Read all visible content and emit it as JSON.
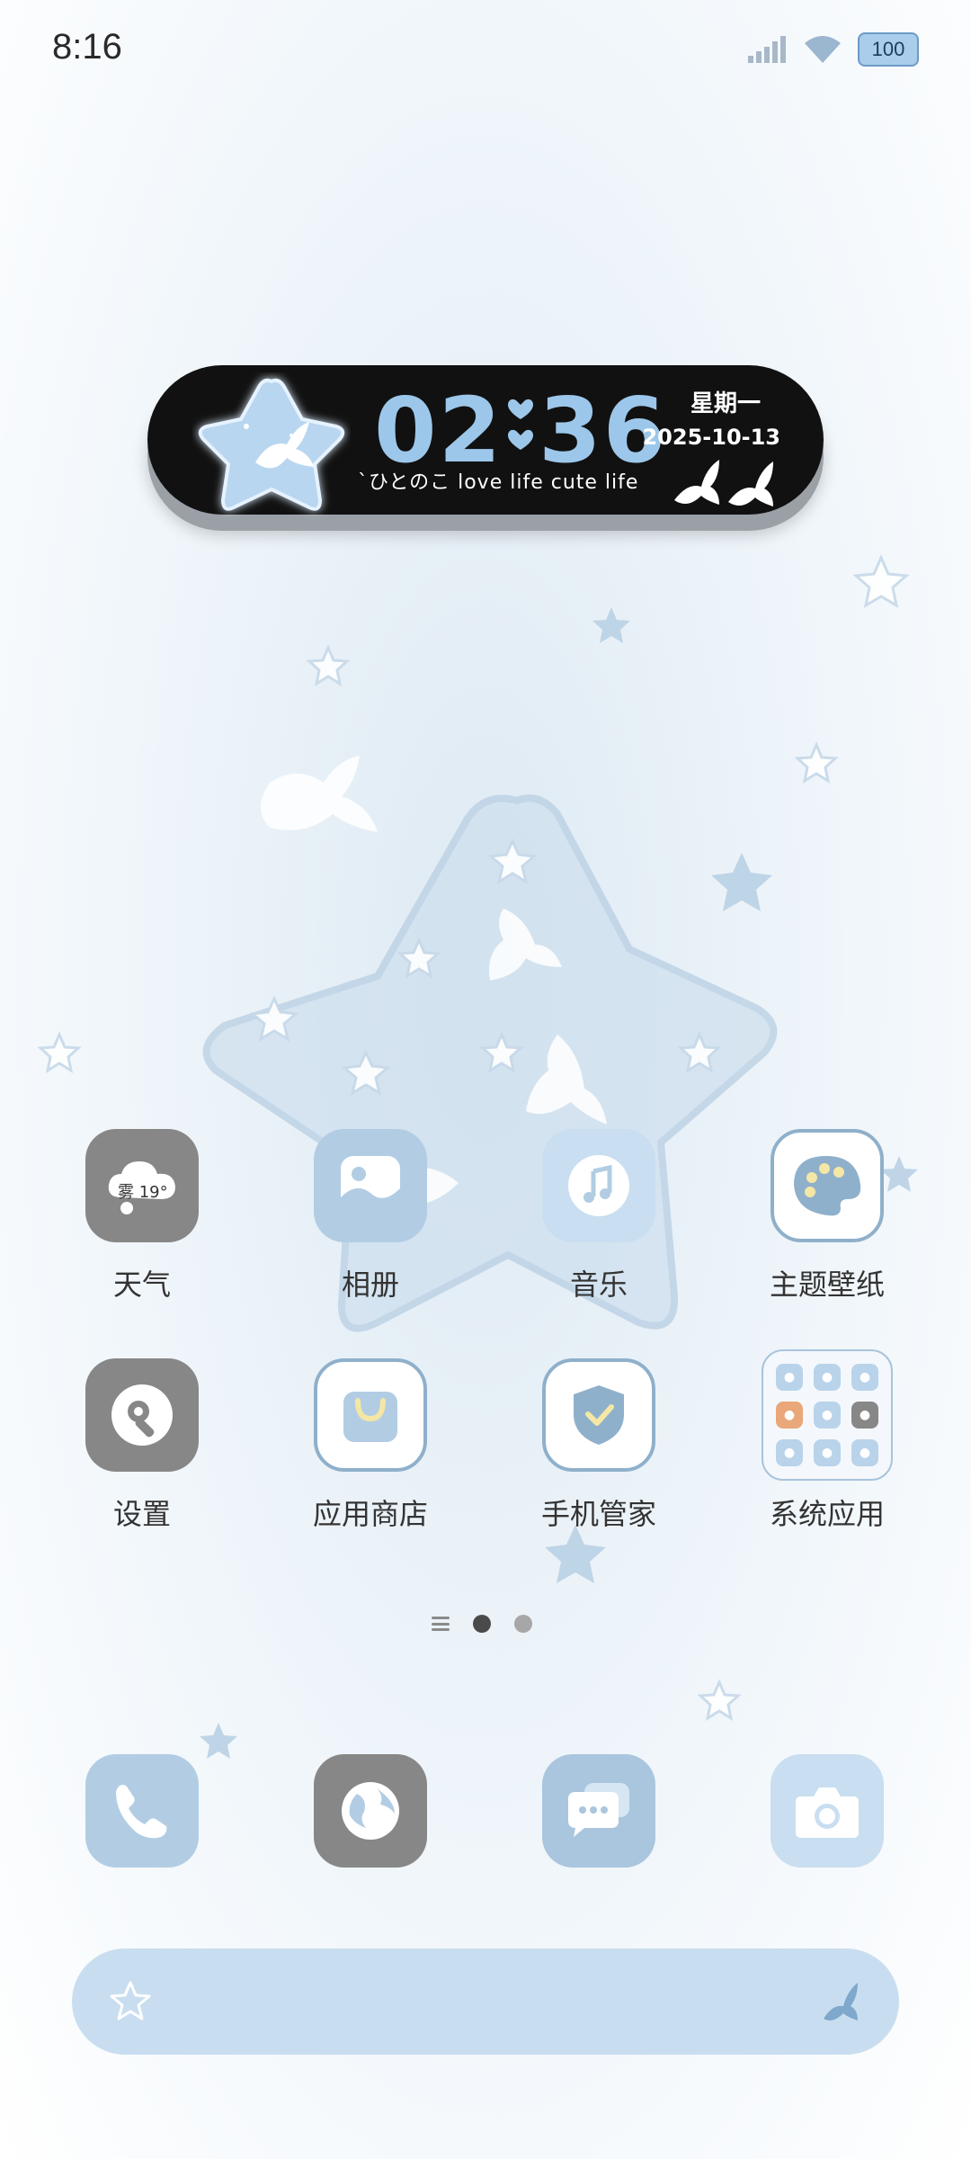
{
  "status_bar": {
    "time": "8:16",
    "battery": "100",
    "icons": [
      "signal-icon",
      "wifi-icon",
      "battery-icon"
    ]
  },
  "clock_widget": {
    "hours": "02",
    "minutes": "36",
    "weekday": "星期一",
    "date": "2025-10-13",
    "slogan": "`ひとのこ love life cute life"
  },
  "apps": [
    {
      "label": "天气",
      "icon": "weather-icon",
      "badge": "雾 19°"
    },
    {
      "label": "相册",
      "icon": "gallery-icon"
    },
    {
      "label": "音乐",
      "icon": "music-icon"
    },
    {
      "label": "主题壁纸",
      "icon": "palette-icon"
    },
    {
      "label": "设置",
      "icon": "settings-icon"
    },
    {
      "label": "应用商店",
      "icon": "app-store-icon"
    },
    {
      "label": "手机管家",
      "icon": "security-shield-icon"
    },
    {
      "label": "系统应用",
      "icon": "folder-icon"
    }
  ],
  "pager": {
    "pages": 2,
    "active": 1
  },
  "dock": [
    {
      "icon": "phone-icon"
    },
    {
      "icon": "browser-icon"
    },
    {
      "icon": "messages-icon"
    },
    {
      "icon": "camera-icon"
    }
  ],
  "colors": {
    "accent": "#9cc7ea",
    "icon_gray": "#878787",
    "icon_blue": "#b2cde3",
    "search_bar": "#c8def0"
  }
}
